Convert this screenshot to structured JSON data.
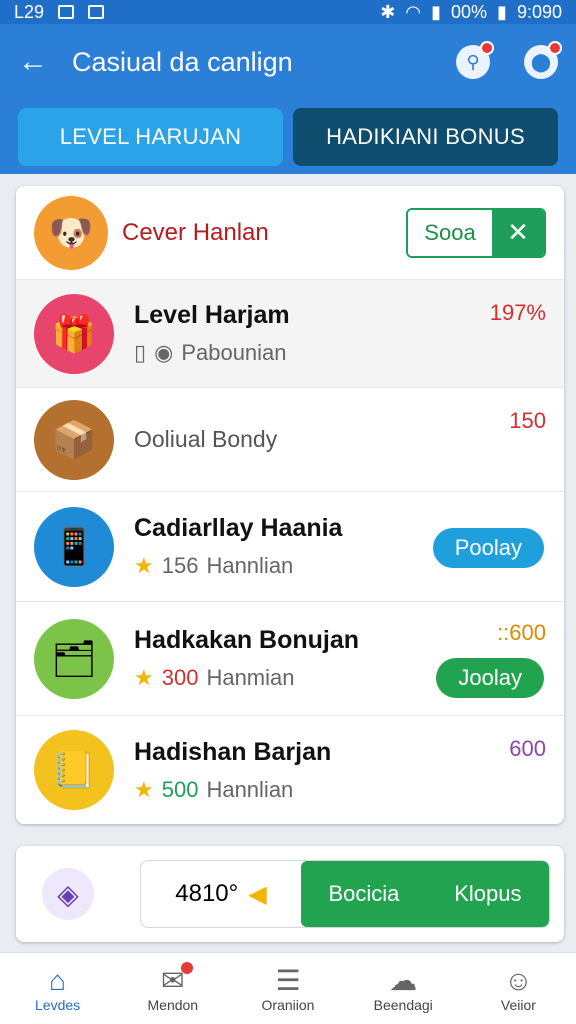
{
  "status_bar": {
    "left_text": "L29",
    "battery": "00%",
    "time": "9:090"
  },
  "header": {
    "title": "Casiual da canlign"
  },
  "tabs": [
    {
      "label": "LEVEL HARUJAN",
      "active": true
    },
    {
      "label": "HADIKIANI BONUS",
      "active": false
    }
  ],
  "card_header": {
    "name": "Cever Hanlan",
    "toggle_label": "Sooa",
    "toggle_icon": "✕"
  },
  "rows": [
    {
      "title": "Level Harjam",
      "sub": "Pabounian",
      "value": "197%",
      "icon": "gift-icon"
    },
    {
      "title": "",
      "sub": "Ooliual Bondy",
      "value": "150",
      "icon": "box-icon"
    },
    {
      "title": "Cadiarllay Haania",
      "sub_value": "156",
      "sub": "Hannlian",
      "button": "Poolay",
      "icon": "tablet-icon"
    },
    {
      "title": "Hadkakan Bonujan",
      "sub_value": "300",
      "sub": "Hanmian",
      "value": "::600",
      "button": "Joolay",
      "icon": "card-icon"
    },
    {
      "title": "Hadishan Barjan",
      "sub_value": "500",
      "sub": "Hannlian",
      "value": "600",
      "icon": "notepad-icon"
    }
  ],
  "bottom_bar": {
    "value": "4810°",
    "btn1": "Bocicia",
    "btn2": "Klopus"
  },
  "nav": [
    {
      "label": "Levdes",
      "icon": "home-icon",
      "active": true
    },
    {
      "label": "Mendon",
      "icon": "inbox-icon",
      "active": false
    },
    {
      "label": "Oraniion",
      "icon": "list-icon",
      "active": false
    },
    {
      "label": "Beendagi",
      "icon": "bell-icon",
      "active": false
    },
    {
      "label": "Veiior",
      "icon": "user-icon",
      "active": false
    }
  ],
  "colors": {
    "primary": "#2b7fd6",
    "accent_blue": "#1fa0dc",
    "accent_green": "#1e9e5a",
    "danger": "#d32f2f"
  }
}
